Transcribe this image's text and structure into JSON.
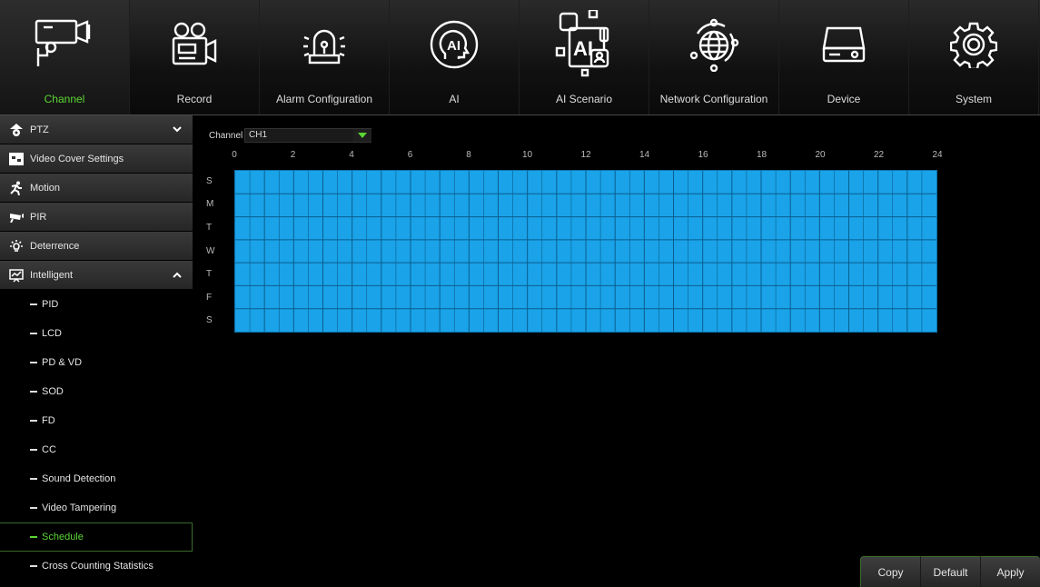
{
  "topnav": {
    "tabs": [
      {
        "label": "Channel",
        "icon": "camera-icon",
        "active": true
      },
      {
        "label": "Record",
        "icon": "video-recorder-icon",
        "active": false
      },
      {
        "label": "Alarm Configuration",
        "icon": "alarm-siren-icon",
        "active": false
      },
      {
        "label": "AI",
        "icon": "ai-head-icon",
        "active": false
      },
      {
        "label": "AI Scenario",
        "icon": "ai-scenario-icon",
        "active": false
      },
      {
        "label": "Network Configuration",
        "icon": "globe-network-icon",
        "active": false
      },
      {
        "label": "Device",
        "icon": "hard-drive-icon",
        "active": false
      },
      {
        "label": "System",
        "icon": "gear-icon",
        "active": false
      }
    ]
  },
  "sidebar": {
    "main_items": [
      {
        "label": "PTZ",
        "icon": "ptz-icon",
        "chevron": "down"
      },
      {
        "label": "Video Cover Settings",
        "icon": "video-cover-icon"
      },
      {
        "label": "Motion",
        "icon": "motion-icon"
      },
      {
        "label": "PIR",
        "icon": "pir-icon"
      },
      {
        "label": "Deterrence",
        "icon": "deterrence-icon"
      },
      {
        "label": "Intelligent",
        "icon": "intelligent-icon",
        "chevron": "up"
      }
    ],
    "sub_items": [
      {
        "label": "PID",
        "active": false
      },
      {
        "label": "LCD",
        "active": false
      },
      {
        "label": "PD & VD",
        "active": false
      },
      {
        "label": "SOD",
        "active": false
      },
      {
        "label": "FD",
        "active": false
      },
      {
        "label": "CC",
        "active": false
      },
      {
        "label": "Sound Detection",
        "active": false
      },
      {
        "label": "Video Tampering",
        "active": false
      },
      {
        "label": "Schedule",
        "active": true
      },
      {
        "label": "Cross Counting Statistics",
        "active": false
      }
    ]
  },
  "main": {
    "channel_label": "Channel",
    "channel_value": "CH1",
    "hours": [
      "0",
      "2",
      "4",
      "6",
      "8",
      "10",
      "12",
      "14",
      "16",
      "18",
      "20",
      "22",
      "24"
    ],
    "days": [
      "S",
      "M",
      "T",
      "W",
      "T",
      "F",
      "S"
    ],
    "schedule_color": "#1aa3e8"
  },
  "buttons": {
    "copy": "Copy",
    "default": "Default",
    "apply": "Apply"
  },
  "colors": {
    "accent_green": "#5bd633",
    "schedule_blue": "#1aa3e8"
  }
}
